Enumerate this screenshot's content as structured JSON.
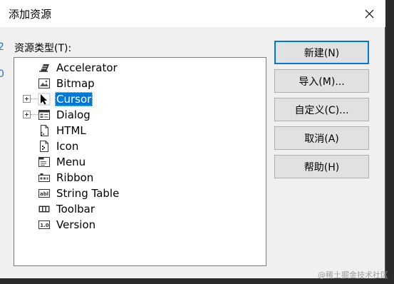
{
  "window": {
    "title": "添加资源",
    "close_icon": "close-icon"
  },
  "resource_list": {
    "label": "资源类型(T):",
    "items": [
      {
        "label": "Accelerator",
        "icon": "accelerator-icon",
        "expandable": false,
        "selected": false
      },
      {
        "label": "Bitmap",
        "icon": "bitmap-icon",
        "expandable": false,
        "selected": false
      },
      {
        "label": "Cursor",
        "icon": "cursor-icon",
        "expandable": true,
        "selected": true
      },
      {
        "label": "Dialog",
        "icon": "dialog-icon",
        "expandable": true,
        "selected": false
      },
      {
        "label": "HTML",
        "icon": "html-icon",
        "expandable": false,
        "selected": false
      },
      {
        "label": "Icon",
        "icon": "icon-resource-icon",
        "expandable": false,
        "selected": false
      },
      {
        "label": "Menu",
        "icon": "menu-icon",
        "expandable": false,
        "selected": false
      },
      {
        "label": "Ribbon",
        "icon": "ribbon-icon",
        "expandable": false,
        "selected": false
      },
      {
        "label": "String Table",
        "icon": "string-table-icon",
        "expandable": false,
        "selected": false
      },
      {
        "label": "Toolbar",
        "icon": "toolbar-icon",
        "expandable": false,
        "selected": false
      },
      {
        "label": "Version",
        "icon": "version-icon",
        "expandable": false,
        "selected": false
      }
    ]
  },
  "buttons": {
    "new": "新建(N)",
    "import": "导入(M)...",
    "custom": "自定义(C)...",
    "cancel": "取消(A)",
    "help": "帮助(H)"
  },
  "colors": {
    "selection": "#0078d7",
    "dialog_bg": "#f0f0f0"
  },
  "watermark": "@稀土掘金技术社区"
}
